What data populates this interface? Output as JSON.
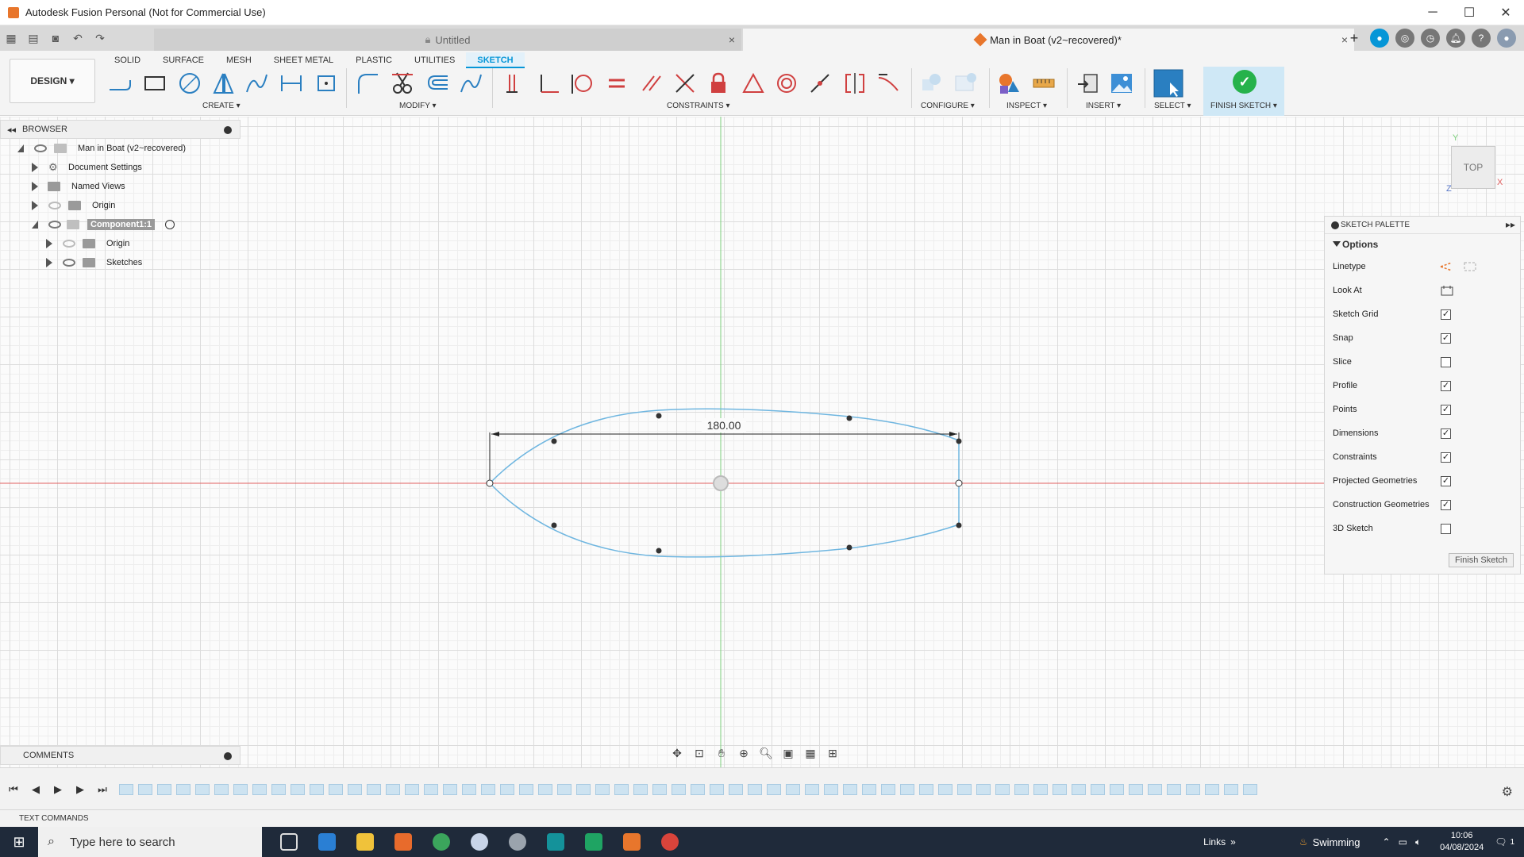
{
  "window": {
    "title": "Autodesk Fusion Personal (Not for Commercial Use)",
    "minimize": "─",
    "maximize": "☐",
    "close": "✕"
  },
  "tabs": {
    "untitled": "Untitled",
    "active": "Man in Boat (v2~recovered)*",
    "close": "×"
  },
  "ribbon": {
    "workspace_tabs": [
      "SOLID",
      "SURFACE",
      "MESH",
      "SHEET METAL",
      "PLASTIC",
      "UTILITIES",
      "SKETCH"
    ],
    "design": "DESIGN ▾",
    "groups": {
      "create": "CREATE ▾",
      "modify": "MODIFY ▾",
      "constraints": "CONSTRAINTS ▾",
      "configure": "CONFIGURE ▾",
      "inspect": "INSPECT ▾",
      "insert": "INSERT ▾",
      "select": "SELECT ▾",
      "finish_sketch": "FINISH SKETCH ▾"
    }
  },
  "browser": {
    "header": "BROWSER",
    "items": [
      {
        "label": "Man in Boat (v2~recovered)"
      },
      {
        "label": "Document Settings"
      },
      {
        "label": "Named Views"
      },
      {
        "label": "Origin"
      },
      {
        "label": "Component1:1"
      },
      {
        "label": "Origin"
      },
      {
        "label": "Sketches"
      }
    ]
  },
  "sketch": {
    "dimension": "180.00",
    "line_color": "#6fb6e0"
  },
  "viewcube": {
    "face": "TOP",
    "y_axis": "Y",
    "x_axis": "X",
    "z_axis": "Z"
  },
  "palette": {
    "header": "SKETCH PALETTE",
    "options_header": "Options",
    "rows": [
      {
        "label": "Linetype"
      },
      {
        "label": "Look At"
      },
      {
        "label": "Sketch Grid",
        "checked": "✓"
      },
      {
        "label": "Snap",
        "checked": "✓"
      },
      {
        "label": "Slice",
        "checked": ""
      },
      {
        "label": "Profile",
        "checked": "✓"
      },
      {
        "label": "Points",
        "checked": "✓"
      },
      {
        "label": "Dimensions",
        "checked": "✓"
      },
      {
        "label": "Constraints",
        "checked": "✓"
      },
      {
        "label": "Projected Geometries",
        "checked": "✓"
      },
      {
        "label": "Construction Geometries",
        "checked": "✓"
      },
      {
        "label": "3D Sketch",
        "checked": ""
      }
    ],
    "finish_button": "Finish Sketch"
  },
  "comments": {
    "label": "COMMENTS"
  },
  "text_commands": {
    "label": "TEXT COMMANDS"
  },
  "taskbar": {
    "search_placeholder": "Type here to search",
    "links": "Links",
    "weather": "Swimming",
    "time": "10:06",
    "date": "04/08/2024",
    "notification_count": "1"
  },
  "colors": {
    "accent": "#0696d7",
    "finish_green": "#26b24b",
    "axis_red": "#e06060",
    "axis_green": "#7ccf7c"
  }
}
